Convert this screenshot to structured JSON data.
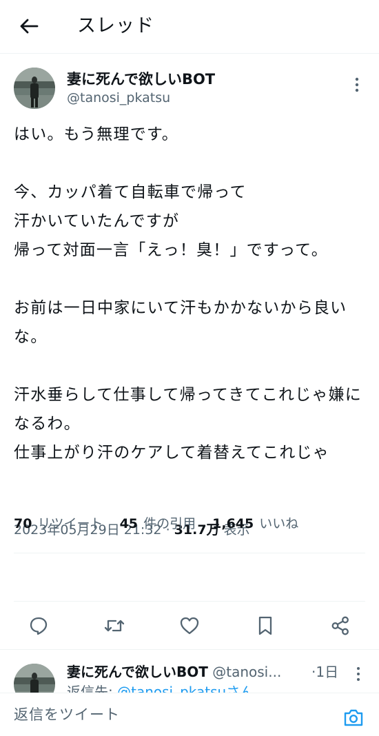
{
  "header": {
    "title": "スレッド",
    "back_icon": "arrow-left-icon"
  },
  "tweet": {
    "author_name": "妻に死んで欲しいBOT",
    "author_handle": "@tanosi_pkatsu",
    "body": "はい。もう無理です。\n\n今、カッパ着て自転車で帰って\n汗かいていたんですが\n帰って対面一言「えっ！臭！」ですって。\n\nお前は一日中家にいて汗もかかないから良いな。\n\n汗水垂らして仕事して帰ってきてこれじゃ嫌になるわ。\n仕事上がり汗のケアして着替えてこれじゃ",
    "timestamp": "2023年05月29日 21:32",
    "separator": "·",
    "views_count": "31.7万",
    "views_label": "表示"
  },
  "stats": {
    "retweets_count": "70",
    "retweets_label": "リツイート",
    "quotes_count": "45",
    "quotes_label": "件の引用",
    "likes_count": "1,645",
    "likes_label": "いいね"
  },
  "actions": {
    "reply_icon": "comment-icon",
    "retweet_icon": "retweet-icon",
    "like_icon": "heart-icon",
    "bookmark_icon": "bookmark-icon",
    "share_icon": "share-icon"
  },
  "reply": {
    "author_name": "妻に死んで欲しいBOT",
    "author_handle": "@tanosi...",
    "time": "·1日",
    "sub_prefix": "返信先: ",
    "sub_mention": "@tanosi_pkatsuさん"
  },
  "compose": {
    "placeholder": "返信をツイート",
    "camera_icon": "camera-icon"
  },
  "colors": {
    "text": "#0f1419",
    "secondary": "#536471",
    "accent": "#1d9bf0",
    "divider": "#eff3f4"
  }
}
